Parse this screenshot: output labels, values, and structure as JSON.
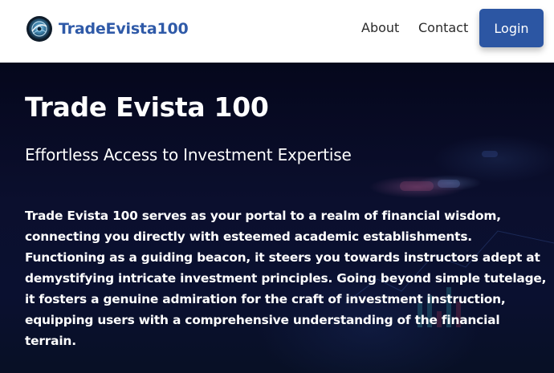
{
  "header": {
    "brand_name": "TradeEvista100",
    "nav": {
      "about": "About",
      "contact": "Contact"
    },
    "login_label": "Login"
  },
  "hero": {
    "title": "Trade Evista 100",
    "subtitle": "Effortless Access to Investment Expertise",
    "description": "Trade Evista 100 serves as your portal to a realm of financial wisdom, connecting you directly with esteemed academic establishments. Functioning as a guiding beacon, it steers you towards instructors adept at demystifying intricate investment principles. Going beyond simple tutelage, it fosters a genuine admiration for the craft of investment instruction, equipping users with a comprehensive understanding of the financial terrain."
  },
  "colors": {
    "brand": "#2f5aa8",
    "login_button": "#2c56a3",
    "hero_background": "#0b0f2e",
    "nav_text": "#2a2a2a",
    "hero_text": "#ffffff"
  },
  "icons": {
    "logo": "brand-logo-icon"
  }
}
